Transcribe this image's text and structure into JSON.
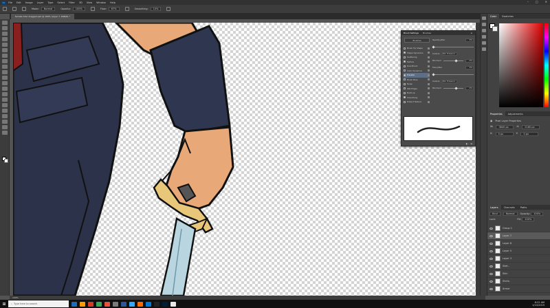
{
  "menubar": {
    "logo": "Ps",
    "items": [
      "File",
      "Edit",
      "Image",
      "Layer",
      "Type",
      "Select",
      "Filter",
      "3D",
      "View",
      "Window",
      "Help"
    ],
    "window_controls": [
      "–",
      "□",
      "✕"
    ]
  },
  "options": {
    "mode_label": "Mode:",
    "mode_value": "Normal",
    "opacity_label": "Opacity:",
    "opacity_value": "100%",
    "flow_label": "Flow:",
    "flow_value": "67%",
    "smoothing_label": "Smoothing:",
    "smoothing_value": "10%"
  },
  "document": {
    "tab_title": "female rider dragged.psd @ 100% (Layer 7, RGB/8) *"
  },
  "status": {
    "zoom": "100%"
  },
  "brush_settings": {
    "tabs": [
      "Brush Settings",
      "Brushes"
    ],
    "presets_button": "Brushes",
    "options": [
      {
        "label": "Brush Tip Shape",
        "checked": false,
        "selected": false
      },
      {
        "label": "Shape Dynamics",
        "checked": true,
        "selected": false
      },
      {
        "label": "Scattering",
        "checked": false,
        "selected": false
      },
      {
        "label": "Texture",
        "checked": true,
        "selected": false
      },
      {
        "label": "Dual Brush",
        "checked": false,
        "selected": false
      },
      {
        "label": "Color Dynamics",
        "checked": false,
        "selected": false
      },
      {
        "label": "Transfer",
        "checked": true,
        "selected": true
      },
      {
        "label": "Brush Pose",
        "checked": false,
        "selected": false
      },
      {
        "label": "Noise",
        "checked": false,
        "selected": false
      },
      {
        "label": "Wet Edges",
        "checked": false,
        "selected": false
      },
      {
        "label": "Build-up",
        "checked": false,
        "selected": false
      },
      {
        "label": "Smoothing",
        "checked": true,
        "selected": false
      },
      {
        "label": "Protect Texture",
        "checked": false,
        "selected": false
      }
    ],
    "opacity_jitter_label": "Opacity Jitter",
    "opacity_jitter_value": "0%",
    "control_label": "Control:",
    "control_value": "Pen Pressure",
    "minimum_label": "Minimum",
    "minimum_value": "0%",
    "flow_jitter_label": "Flow Jitter",
    "flow_jitter_value": "0%",
    "flow_minimum_value": "0%"
  },
  "right_panel": {
    "color_tabs": [
      "Color",
      "Swatches"
    ],
    "properties_tabs": [
      "Properties",
      "Adjustments"
    ],
    "properties_title": "Pixel Layer Properties",
    "w_label": "W:",
    "w_value": "3840 px",
    "h_label": "H:",
    "h_value": "2160 px",
    "x_label": "X:",
    "x_value": "0 px",
    "y_label": "Y:",
    "y_value": "0 px",
    "layers_tabs": [
      "Layers",
      "Channels",
      "Paths"
    ],
    "kind_label": "Kind",
    "blend_mode": "Normal",
    "opacity_label": "Opacity:",
    "opacity_value": "100%",
    "lock_label": "Lock:",
    "fill_label": "Fill:",
    "fill_value": "100%",
    "layers": [
      {
        "name": "Group 1",
        "selected": false
      },
      {
        "name": "Layer 7",
        "selected": true
      },
      {
        "name": "Layer 6",
        "selected": false
      },
      {
        "name": "Layer 5",
        "selected": false
      },
      {
        "name": "Layer 3",
        "selected": false
      },
      {
        "name": "Sket..",
        "selected": false
      },
      {
        "name": "Skin",
        "selected": false
      },
      {
        "name": "Shirts",
        "selected": false
      },
      {
        "name": "Armor",
        "selected": false
      }
    ]
  },
  "taskbar": {
    "search_placeholder": "Type here to search",
    "time": "8:22 AM",
    "date": "1/10/2019",
    "icon_colors": [
      "#1e6bb8",
      "#ff9a00",
      "#d63b2a",
      "#3aa657",
      "#e84f3c",
      "#7a7a7a",
      "#2b5797",
      "#31a8ff",
      "#ff6a00",
      "#0078d7",
      "#222222",
      "#001e36",
      "#e8e8e8"
    ]
  }
}
